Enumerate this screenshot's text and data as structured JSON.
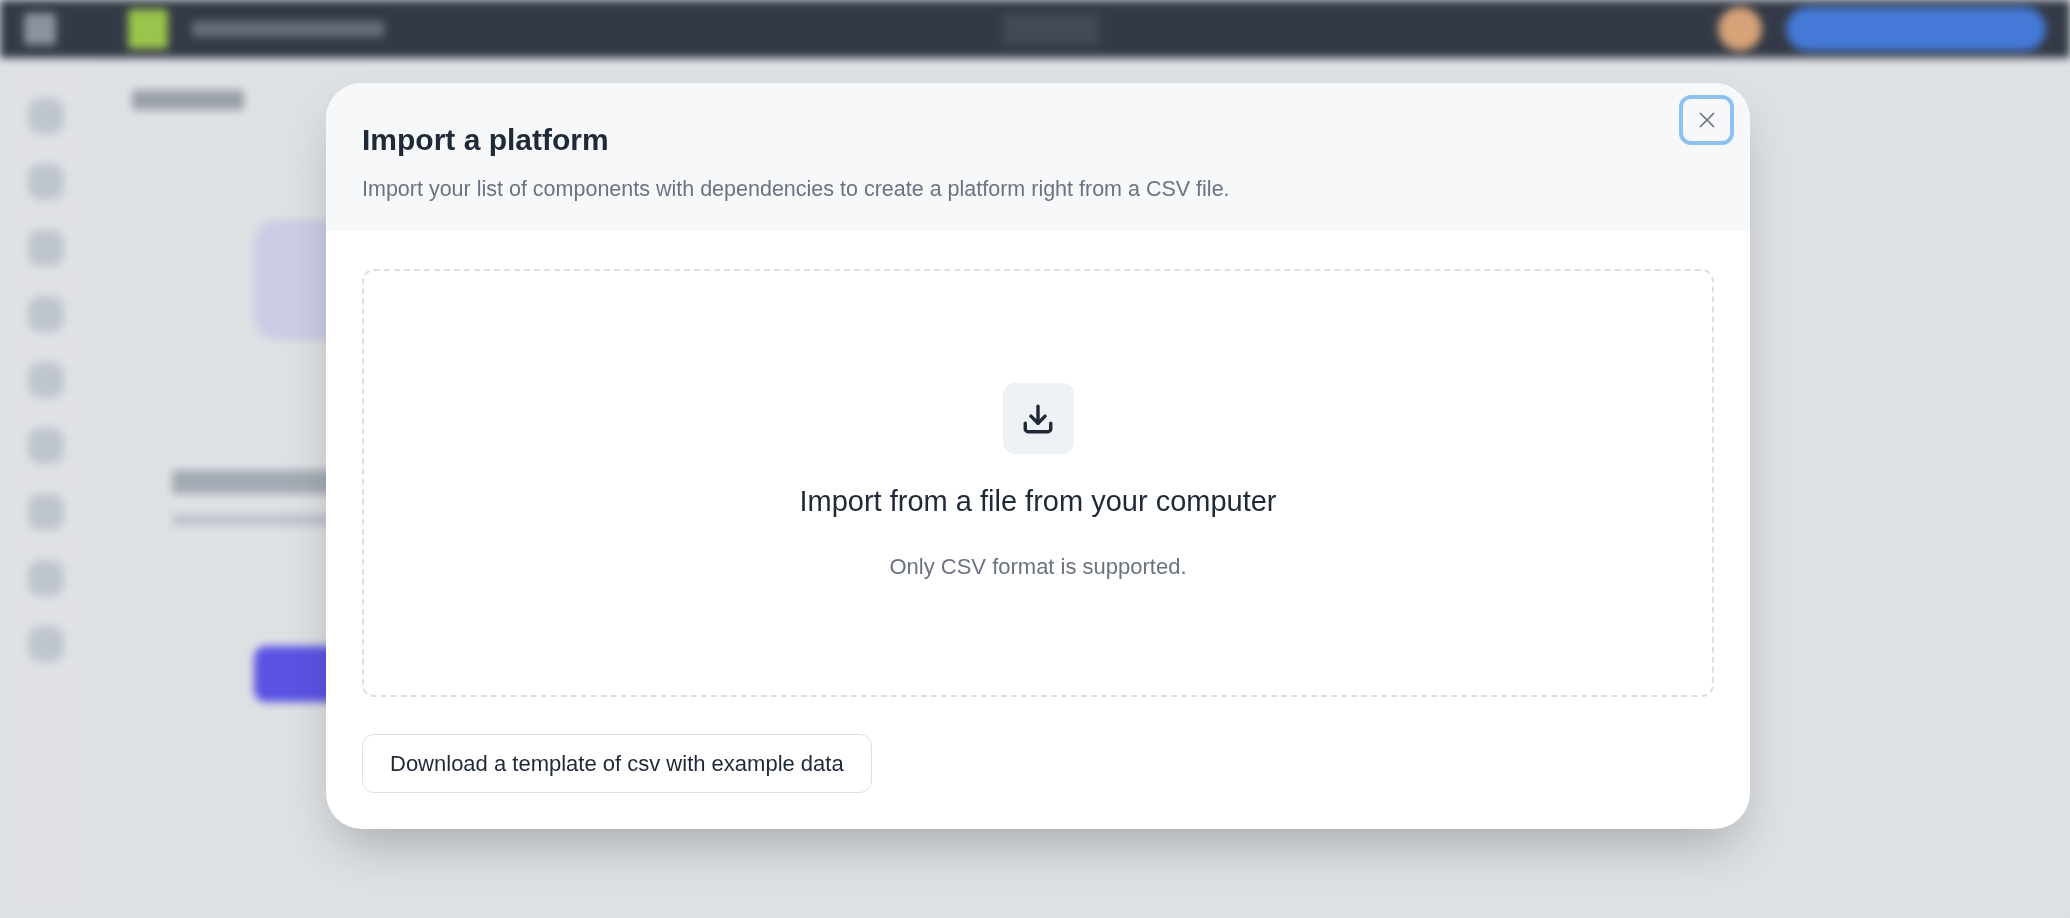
{
  "dialog": {
    "title": "Import a platform",
    "description": "Import your list of components with dependencies to create a platform right from a CSV file.",
    "dropzone": {
      "heading": "Import from a file from your computer",
      "hint": "Only CSV format is supported."
    },
    "template_button": "Download a template of csv with example data"
  }
}
